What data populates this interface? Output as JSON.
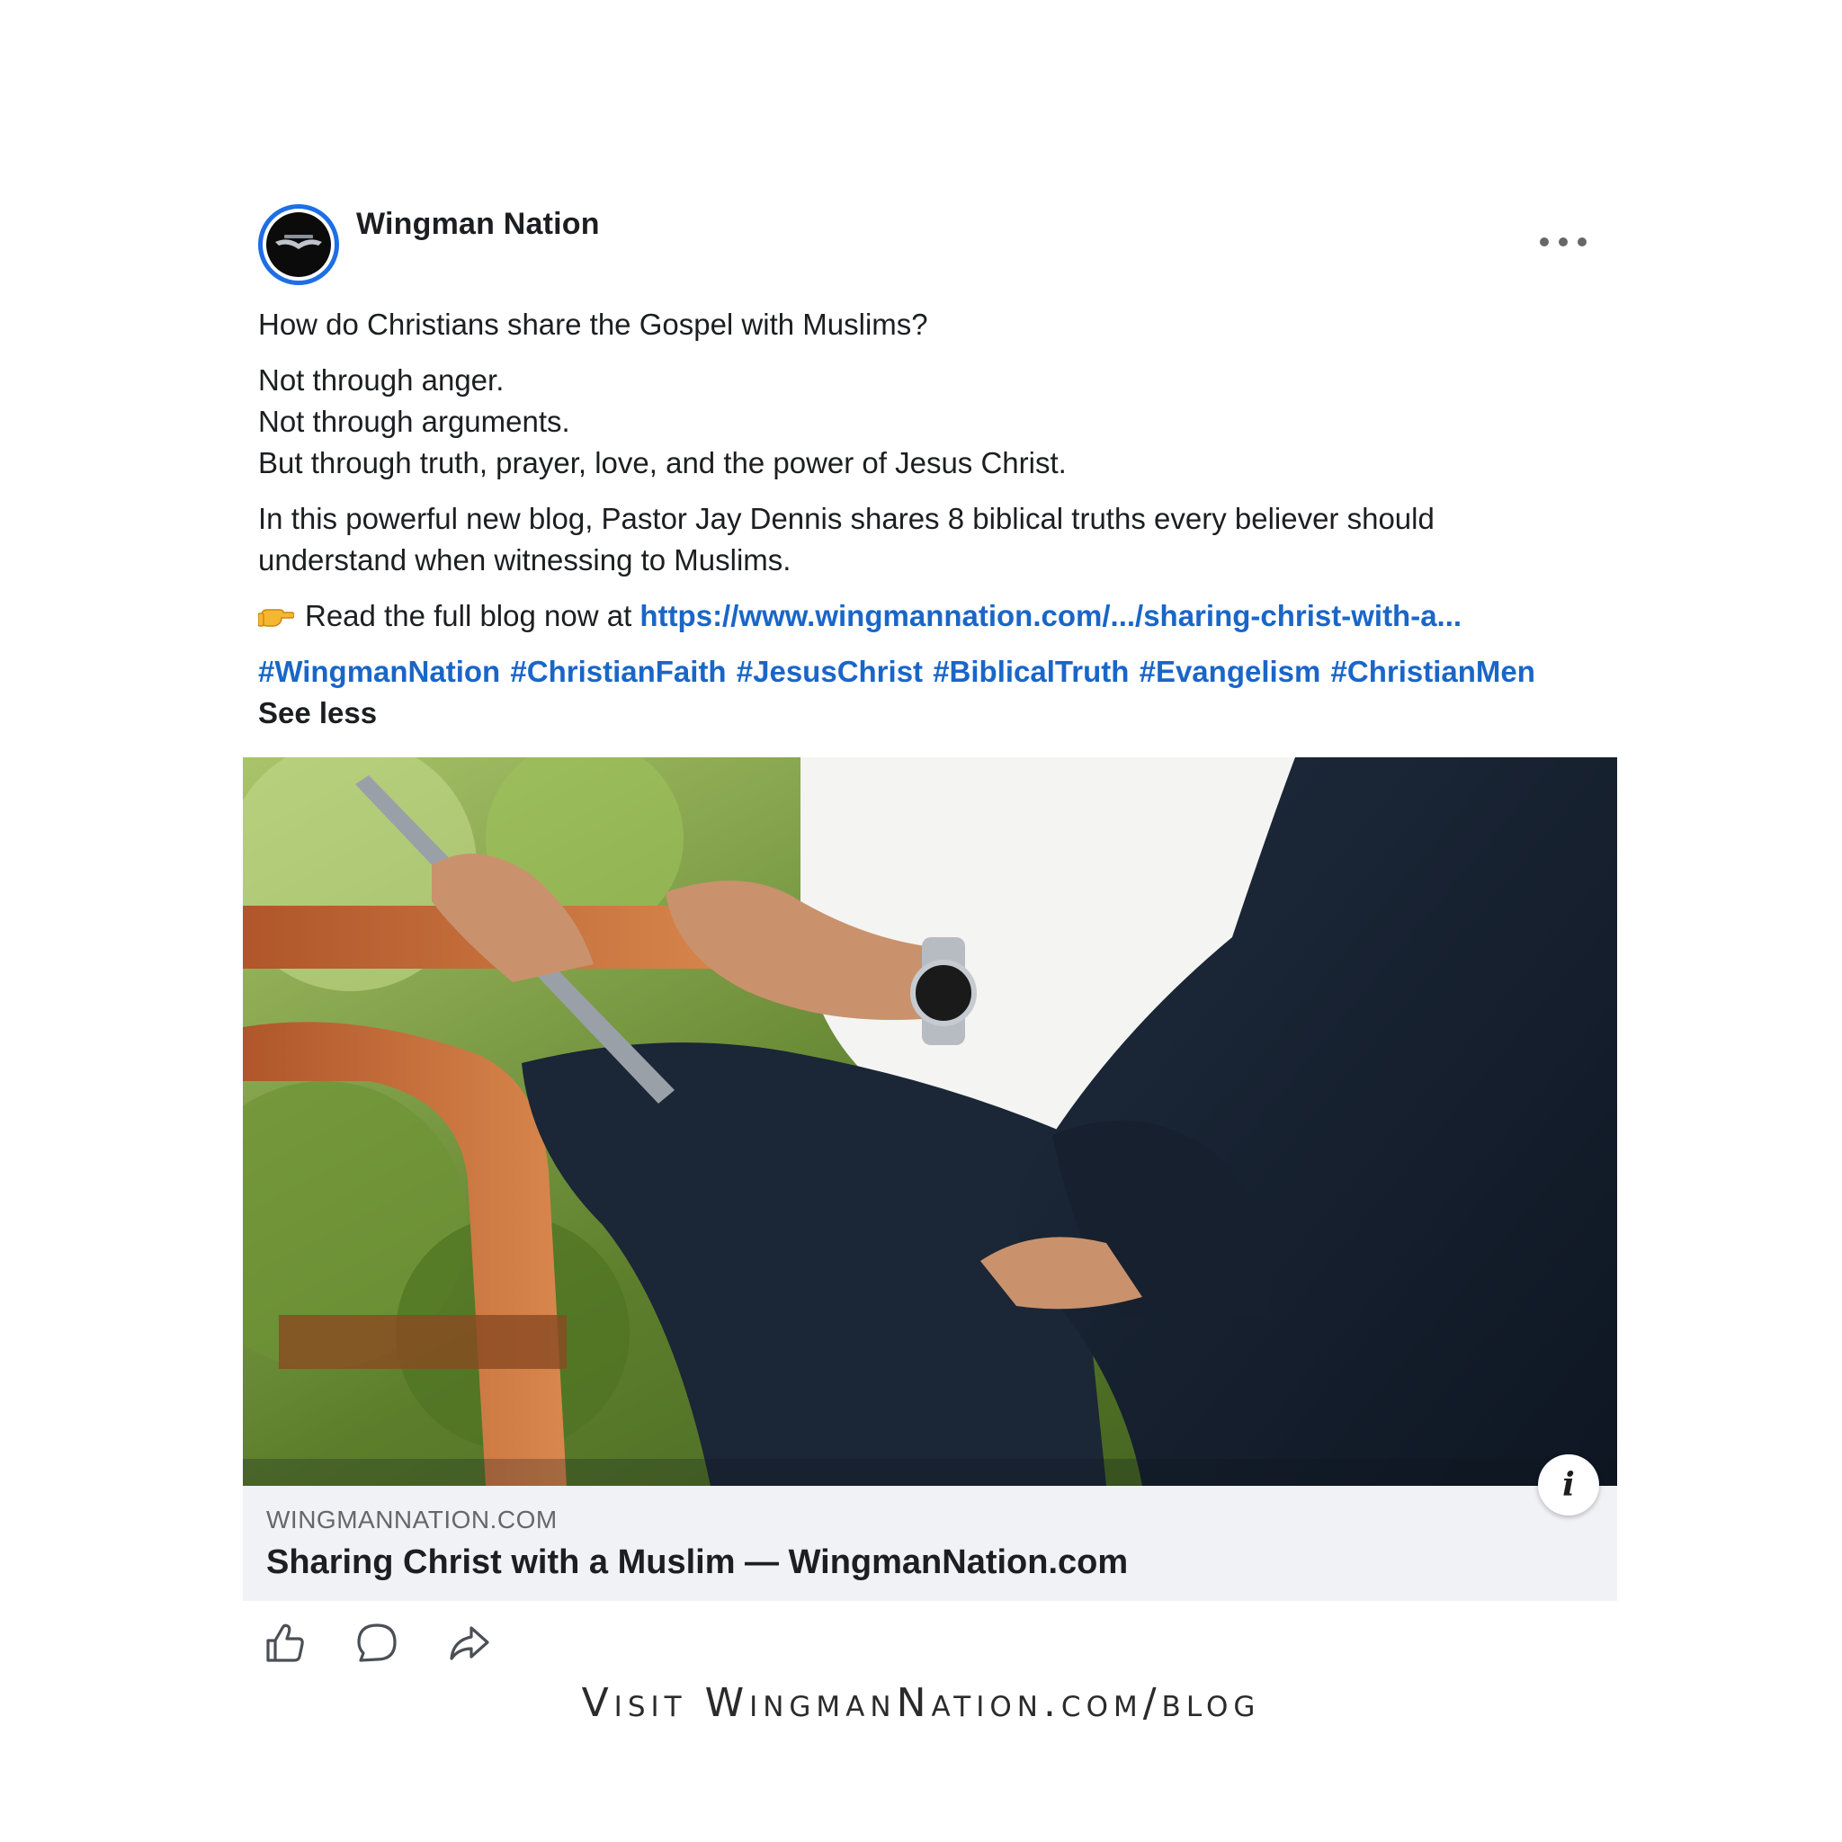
{
  "post": {
    "author": "Wingman Nation",
    "question": "How do Christians share the Gospel with Muslims?",
    "lines": [
      "Not through anger.",
      "Not through arguments.",
      "But through truth, prayer, love, and the power of Jesus Christ."
    ],
    "blurb": "In this powerful new blog, Pastor Jay Dennis shares 8 biblical truths every believer should understand when witnessing to Muslims.",
    "read_prefix": "Read the full blog now at ",
    "read_link": "https://www.wingmannation.com/.../sharing-christ-with-a...",
    "hashtags": [
      "#WingmanNation",
      "#ChristianFaith",
      "#JesusChrist",
      "#BiblicalTruth",
      "#Evangelism",
      "#ChristianMen"
    ],
    "see_less": "See less"
  },
  "preview": {
    "domain": "WINGMANNATION.COM",
    "title": "Sharing Christ with a Muslim — WingmanNation.com",
    "info_icon": "i"
  },
  "footer": {
    "caption": "Visit WingmanNation.com/blog"
  },
  "icons": {
    "more": "more-options-icon",
    "like": "like-icon",
    "comment": "comment-icon",
    "share": "share-icon",
    "pointer": "backhand-index-pointing-right-icon"
  },
  "colors": {
    "link": "#1a66c8",
    "avatar_ring": "#1e6ee6",
    "preview_bg": "#f0f2f5"
  }
}
